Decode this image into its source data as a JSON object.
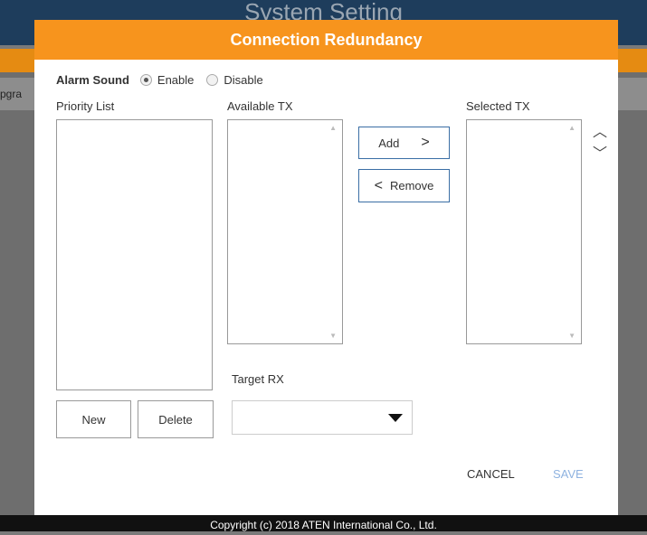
{
  "background": {
    "title": "System Setting",
    "side_text": "pgra"
  },
  "footer": {
    "copyright": "Copyright (c) 2018 ATEN International Co., Ltd."
  },
  "modal": {
    "title": "Connection Redundancy",
    "alarm": {
      "label": "Alarm Sound",
      "options": [
        "Enable",
        "Disable"
      ],
      "selected": "Enable"
    },
    "priority_list": {
      "label": "Priority List"
    },
    "available_tx": {
      "label": "Available TX"
    },
    "selected_tx": {
      "label": "Selected TX"
    },
    "target_rx": {
      "label": "Target RX",
      "value": ""
    },
    "buttons": {
      "add": "Add",
      "remove": "Remove",
      "new": "New",
      "delete": "Delete",
      "cancel": "CANCEL",
      "save": "SAVE"
    },
    "colors": {
      "header": "#f7941d",
      "save_text": "#8fb3e0",
      "button_border": "#3a6ea5"
    }
  }
}
